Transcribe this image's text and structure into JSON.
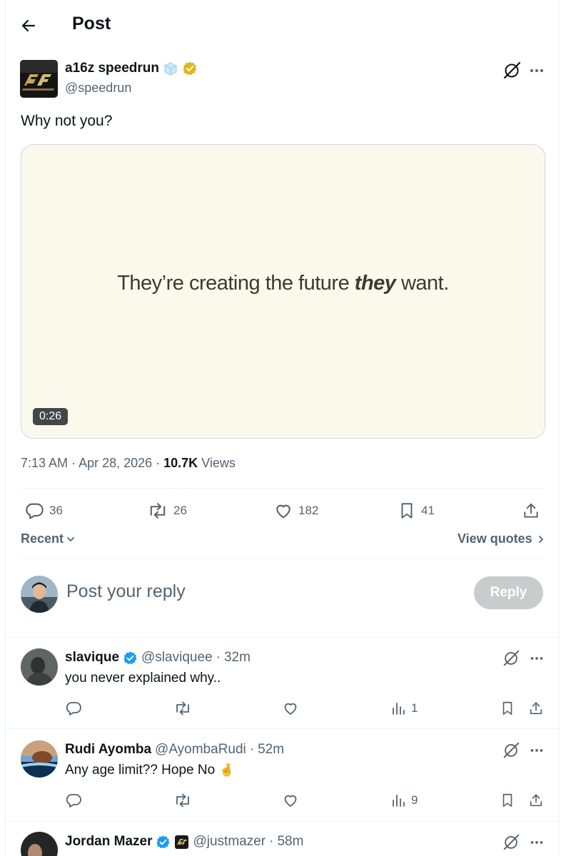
{
  "header": {
    "title": "Post"
  },
  "post": {
    "author_name": "a16z speedrun",
    "author_handle": "@speedrun",
    "text": "Why not you?",
    "media": {
      "caption_before": "They’re creating the future ",
      "caption_emphasis": "they",
      "caption_after": " want.",
      "duration": "0:26"
    },
    "time": "7:13 AM",
    "date": "Apr 28, 2026",
    "views_count": "10.7K",
    "views_label": "Views",
    "replies": "36",
    "reposts": "26",
    "likes": "182",
    "bookmarks": "41"
  },
  "sort": {
    "label": "Recent",
    "view_quotes": "View quotes"
  },
  "composer": {
    "placeholder": "Post your reply",
    "reply_button": "Reply"
  },
  "replies": [
    {
      "name": "slavique",
      "handle": "@slaviquee",
      "time": "32m",
      "text": "you never explained why..",
      "emoji": "",
      "views": "1",
      "verified": true
    },
    {
      "name": "Rudi Ayomba",
      "handle": "@AyombaRudi",
      "time": "52m",
      "text": "Any age limit?? Hope No",
      "emoji": "🤞",
      "views": "9",
      "verified": false
    },
    {
      "name": "Jordan Mazer",
      "handle": "@justmazer",
      "time": "58m",
      "verified": true
    }
  ],
  "colors": {
    "verified_blue": "#1d9bf0",
    "verified_gold": "#e2b719",
    "text": "#0f1419",
    "muted": "#536471",
    "media_bg": "#fbf9ec"
  }
}
